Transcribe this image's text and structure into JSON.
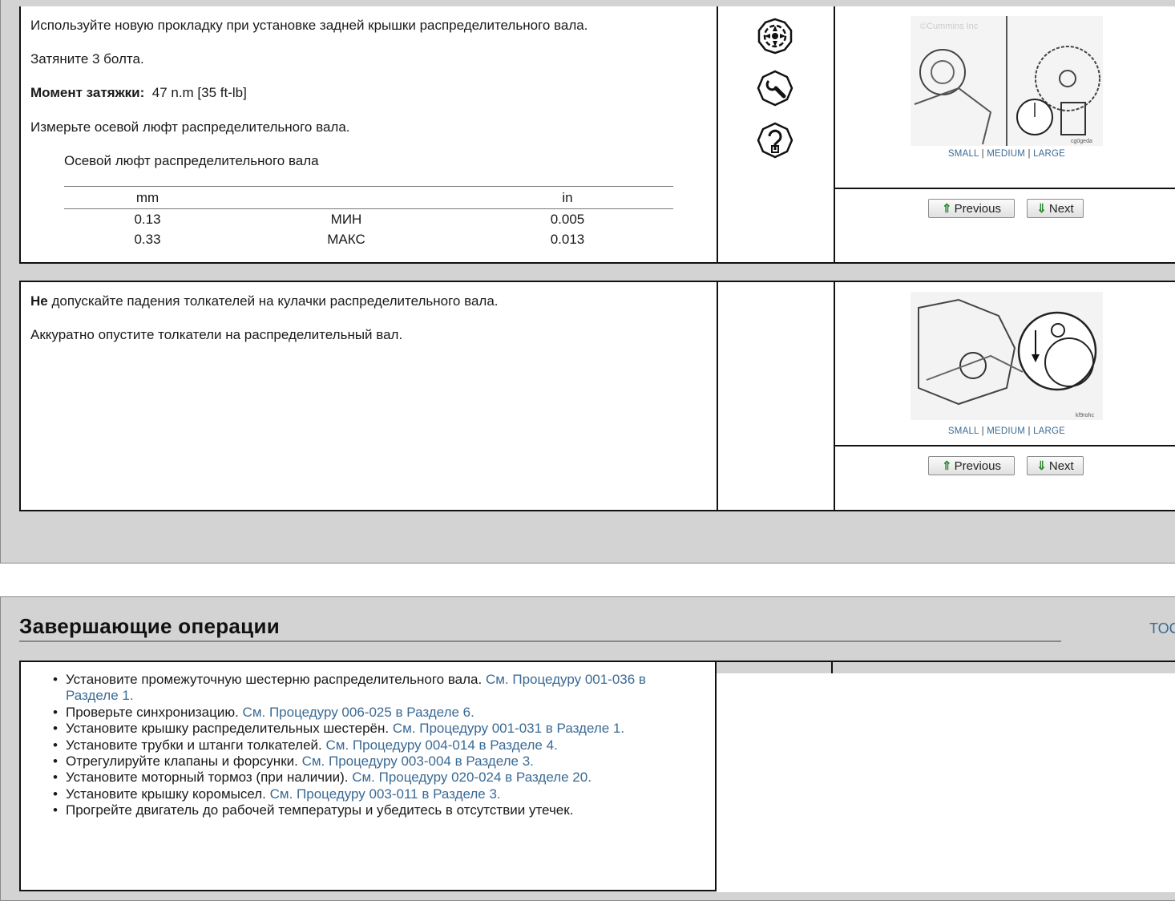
{
  "step1": {
    "text": {
      "line1": "Используйте новую прокладку при установке задней крышки распределительного вала.",
      "line2": "Затяните 3 болта.",
      "torque_label": "Момент затяжки:",
      "torque_value": "47  n.m  [35 ft-lb]",
      "line4": "Измерьте осевой люфт распределительного вала.",
      "table_title": "Осевой люфт распределительного вала"
    },
    "spec_table": {
      "headers": [
        "mm",
        "",
        "in"
      ],
      "rows": [
        [
          "0.13",
          "МИН",
          "0.005"
        ],
        [
          "0.33",
          "МАКС",
          "0.013"
        ]
      ]
    },
    "icons": [
      "gear-icon",
      "wrench-icon",
      "measure-icon"
    ],
    "image": {
      "watermark": "©Cummins Inc",
      "code": "cg0geda"
    },
    "size_links": {
      "small": "SMALL",
      "medium": "MEDIUM",
      "large": "LARGE",
      "sep": "|"
    },
    "nav": {
      "previous": "Previous",
      "next": "Next"
    }
  },
  "step2": {
    "text": {
      "line1_bold": "Не",
      "line1_rest": " допускайте падения толкателей на кулачки распределительного вала.",
      "line2": "Аккуратно опустите толкатели на распределительный вал."
    },
    "image": {
      "code": "kf9rohc"
    },
    "size_links": {
      "small": "SMALL",
      "medium": "MEDIUM",
      "large": "LARGE",
      "sep": "|"
    },
    "nav": {
      "previous": "Previous",
      "next": "Next"
    }
  },
  "finishing": {
    "heading": "Завершающие операции",
    "toc": "TOC",
    "items": [
      {
        "text": "Установите промежуточную шестерню распределительного вала. ",
        "link": "См. Процедуру 001-036 в Разделе 1."
      },
      {
        "text": "Проверьте синхронизацию. ",
        "link": "См. Процедуру 006-025 в Разделе 6."
      },
      {
        "text": "Установите крышку распределительных шестерён. ",
        "link": "См. Процедуру 001-031 в Разделе 1."
      },
      {
        "text": "Установите трубки и штанги толкателей. ",
        "link": "См. Процедуру 004-014 в Разделе 4."
      },
      {
        "text": "Отрегулируйте клапаны и форсунки. ",
        "link": "См. Процедуру 003-004 в Разделе 3."
      },
      {
        "text": "Установите моторный тормоз (при наличии). ",
        "link": "См. Процедуру 020-024 в Разделе 20."
      },
      {
        "text": "Установите крышку коромысел. ",
        "link": "См. Процедуру 003-011 в Разделе 3."
      },
      {
        "text": "Прогрейте двигатель до рабочей температуры и убедитесь в отсутствии утечек.",
        "link": ""
      }
    ]
  },
  "colors": {
    "link": "#3b6a94",
    "panel": "#d3d3d3",
    "border": "#111111"
  }
}
